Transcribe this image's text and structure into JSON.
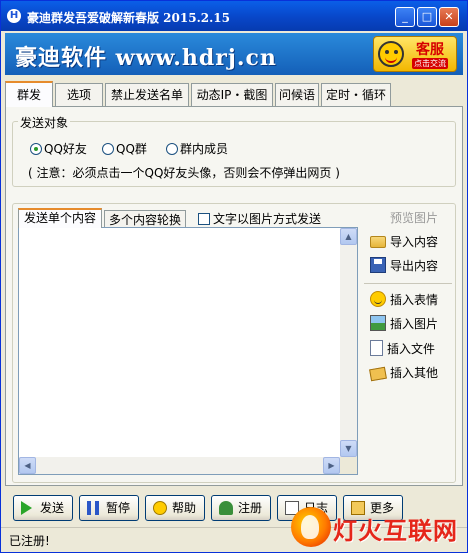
{
  "window": {
    "title": "豪迪群发吾爱破解新春版 2015.2.15",
    "controls": {
      "minimize": "_",
      "maximize": "□",
      "close": "✕"
    }
  },
  "banner": {
    "logo_text": "豪迪软件 www.hdrj.cn",
    "kefu_label": "客服",
    "kefu_sub": "点击交流"
  },
  "tabs": [
    {
      "label": "群发",
      "active": true
    },
    {
      "label": "选项"
    },
    {
      "label": "禁止发送名单"
    },
    {
      "label": "动态IP・截图"
    },
    {
      "label": "问候语"
    },
    {
      "label": "定时・循环"
    }
  ],
  "send_target": {
    "legend": "发送对象",
    "options": [
      {
        "label": "QQ好友",
        "selected": true
      },
      {
        "label": "QQ群",
        "selected": false
      },
      {
        "label": "群内成员",
        "selected": false
      }
    ],
    "note": "( 注意：必须点击一个QQ好友头像，否则会不停弹出网页 )"
  },
  "content": {
    "subtabs": [
      {
        "label": "发送单个内容",
        "active": true
      },
      {
        "label": "多个内容轮换"
      }
    ],
    "image_mode_checkbox": {
      "label": "文字以图片方式发送",
      "checked": false
    },
    "editor_text": ""
  },
  "side_panel": {
    "preview": "预览图片",
    "import": "导入内容",
    "export": "导出内容",
    "insert_emoji": "插入表情",
    "insert_image": "插入图片",
    "insert_file": "插入文件",
    "insert_other": "插入其他"
  },
  "buttons": {
    "send": "发送",
    "pause": "暂停",
    "help": "帮助",
    "register": "注册",
    "log": "日志",
    "extra": "更多"
  },
  "status": {
    "text": "已注册!"
  },
  "watermark": {
    "text": "灯火互联网"
  }
}
